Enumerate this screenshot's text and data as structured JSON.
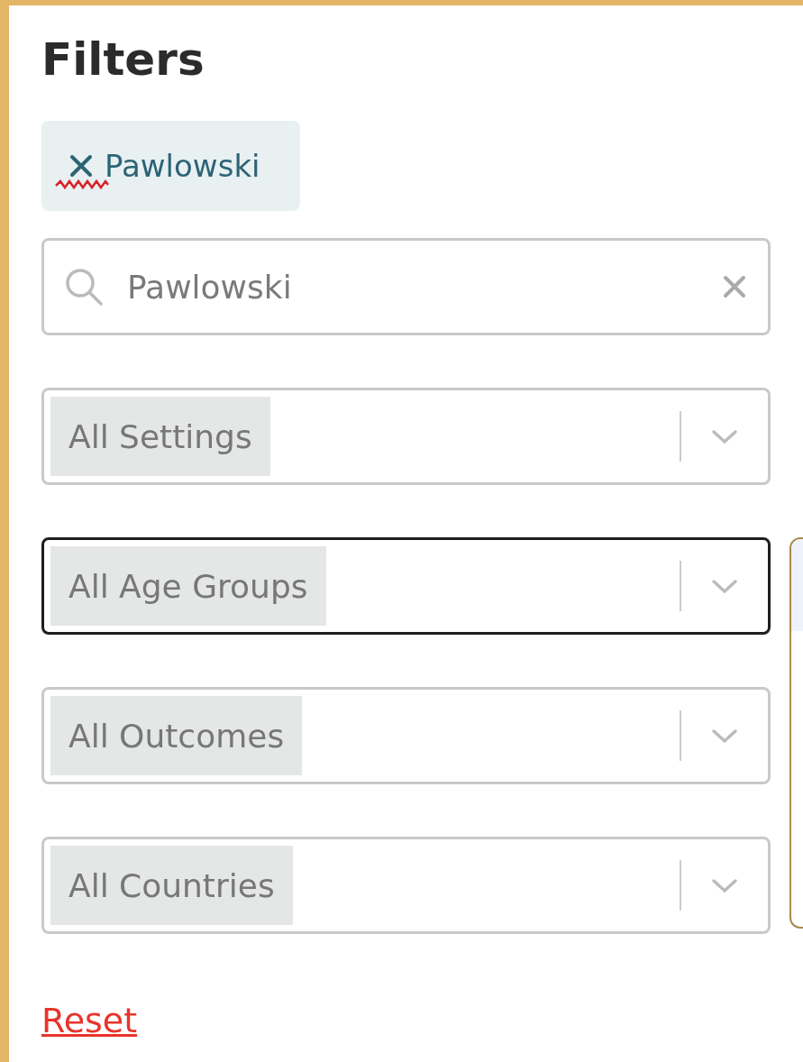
{
  "title": "Filters",
  "chips": [
    {
      "label": "Pawlowski",
      "spellcheck": true
    }
  ],
  "search": {
    "value": "Pawlowski"
  },
  "selects": [
    {
      "label": "All Settings",
      "focused": false
    },
    {
      "label": "All Age Groups",
      "focused": true
    },
    {
      "label": "All Outcomes",
      "focused": false
    },
    {
      "label": "All Countries",
      "focused": false
    }
  ],
  "reset": "Reset"
}
